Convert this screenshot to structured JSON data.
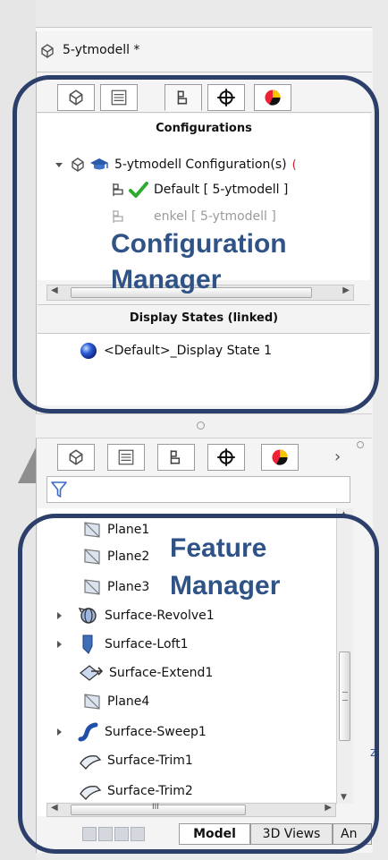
{
  "window": {
    "title": "5-ytmodell *"
  },
  "top_tabs": [
    "part-icon",
    "property-icon",
    "configuration-icon",
    "crosshair-icon",
    "appearance-icon"
  ],
  "configurations": {
    "header": "Configurations",
    "root_label": "5-ytmodell Configuration(s)",
    "items": [
      {
        "label": "Default [ 5-ytmodell ]",
        "active": true
      },
      {
        "label": "enkel [ 5-ytmodell ]",
        "active": false
      }
    ]
  },
  "display_states": {
    "header": "Display States (linked)",
    "items": [
      {
        "label": "<Default>_Display State 1"
      }
    ]
  },
  "annotations": {
    "config_line1": "Configuration",
    "config_line2": "Manager",
    "feature_line1": "Feature",
    "feature_line2": "Manager"
  },
  "feature_tree": {
    "items": [
      {
        "label": "Plane1",
        "icon": "plane-icon",
        "expandable": false
      },
      {
        "label": "Plane2",
        "icon": "plane-icon",
        "expandable": false
      },
      {
        "label": "Plane3",
        "icon": "plane-icon",
        "expandable": false
      },
      {
        "label": "Surface-Revolve1",
        "icon": "surface-revolve-icon",
        "expandable": true
      },
      {
        "label": "Surface-Loft1",
        "icon": "surface-loft-icon",
        "expandable": true
      },
      {
        "label": "Surface-Extend1",
        "icon": "surface-extend-icon",
        "expandable": false
      },
      {
        "label": "Plane4",
        "icon": "plane-icon",
        "expandable": false
      },
      {
        "label": "Surface-Sweep1",
        "icon": "surface-sweep-icon",
        "expandable": true
      },
      {
        "label": "Surface-Trim1",
        "icon": "surface-trim-icon",
        "expandable": false
      },
      {
        "label": "Surface-Trim2",
        "icon": "surface-trim-icon",
        "expandable": false
      }
    ]
  },
  "bottom_tabs": {
    "model": "Model",
    "views3d": "3D Views",
    "next_partial": "An"
  },
  "scroll_grip": "III",
  "colors": {
    "accent": "#2f5386",
    "callout_border": "#2c3f6a",
    "check": "#2eaa2e"
  }
}
